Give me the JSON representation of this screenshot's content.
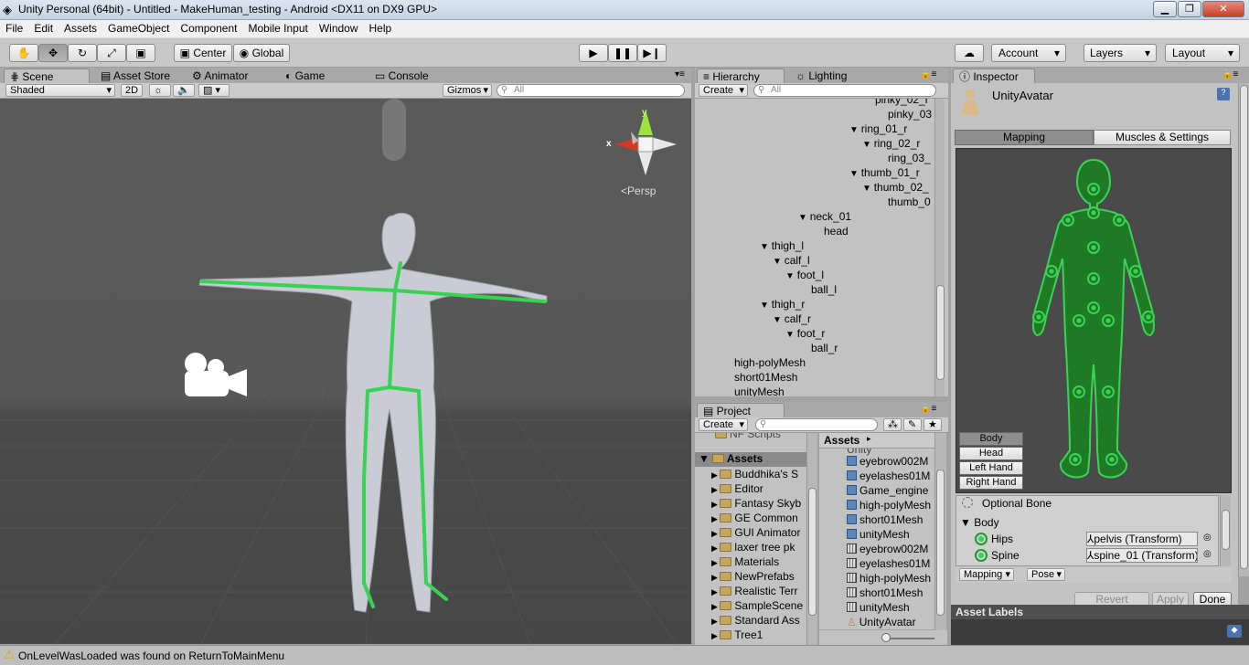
{
  "window": {
    "title": "Unity Personal (64bit) - Untitled - MakeHuman_testing - Android <DX11 on DX9 GPU>"
  },
  "menu": [
    "File",
    "Edit",
    "Assets",
    "GameObject",
    "Component",
    "Mobile Input",
    "Window",
    "Help"
  ],
  "toolbar": {
    "center_label": "Center",
    "global_label": "Global",
    "account_label": "Account",
    "layers_label": "Layers",
    "layout_label": "Layout"
  },
  "scene_tabs": [
    "Scene",
    "Asset Store",
    "Animator",
    "Game",
    "Console"
  ],
  "scene_bar": {
    "shaded": "Shaded",
    "two_d": "2D",
    "gizmos": "Gizmos",
    "search_placeholder": "All"
  },
  "scene": {
    "gizmo_x": "x",
    "gizmo_y": "y",
    "persp": "Persp"
  },
  "hierarchy": {
    "tabs": [
      "Hierarchy",
      "Lighting"
    ],
    "create_label": "Create",
    "search_placeholder": "All",
    "items": [
      {
        "label": "pinky_02_r",
        "indent": 197,
        "arrow": false
      },
      {
        "label": "pinky_03",
        "indent": 211,
        "arrow": false
      },
      {
        "label": "ring_01_r",
        "indent": 183,
        "arrow": true
      },
      {
        "label": "ring_02_r",
        "indent": 197,
        "arrow": true
      },
      {
        "label": "ring_03_",
        "indent": 211,
        "arrow": false
      },
      {
        "label": "thumb_01_r",
        "indent": 183,
        "arrow": true
      },
      {
        "label": "thumb_02_",
        "indent": 197,
        "arrow": true
      },
      {
        "label": "thumb_0",
        "indent": 211,
        "arrow": false
      },
      {
        "label": "neck_01",
        "indent": 127,
        "arrow": true
      },
      {
        "label": "head",
        "indent": 141,
        "arrow": false
      },
      {
        "label": "thigh_l",
        "indent": 85,
        "arrow": true
      },
      {
        "label": "calf_l",
        "indent": 99,
        "arrow": true
      },
      {
        "label": "foot_l",
        "indent": 113,
        "arrow": true
      },
      {
        "label": "ball_l",
        "indent": 127,
        "arrow": false
      },
      {
        "label": "thigh_r",
        "indent": 85,
        "arrow": true
      },
      {
        "label": "calf_r",
        "indent": 99,
        "arrow": true
      },
      {
        "label": "foot_r",
        "indent": 113,
        "arrow": true
      },
      {
        "label": "ball_r",
        "indent": 127,
        "arrow": false
      },
      {
        "label": "high-polyMesh",
        "indent": 43,
        "arrow": false
      },
      {
        "label": "short01Mesh",
        "indent": 43,
        "arrow": false
      },
      {
        "label": "unityMesh",
        "indent": 43,
        "arrow": false
      }
    ]
  },
  "project": {
    "tab": "Project",
    "create_label": "Create",
    "breadcrumb": "Assets",
    "partial_top_left": "NF Scripts",
    "root_label": "Assets",
    "folders": [
      "Buddhika's S",
      "Editor",
      "Fantasy Skyb",
      "GE Common",
      "GUI Animator",
      "laxer tree pk",
      "Materials",
      "NewPrefabs",
      "Realistic Terr",
      "SampleScene",
      "Standard Ass",
      "Tree1"
    ],
    "partial_top_right": "Unity",
    "assets": [
      {
        "label": "eyebrow002M",
        "kind": "mesh"
      },
      {
        "label": "eyelashes01M",
        "kind": "mesh"
      },
      {
        "label": "Game_engine",
        "kind": "mesh"
      },
      {
        "label": "high-polyMesh",
        "kind": "mesh"
      },
      {
        "label": "short01Mesh",
        "kind": "mesh"
      },
      {
        "label": "unityMesh",
        "kind": "mesh"
      },
      {
        "label": "eyebrow002M",
        "kind": "grid"
      },
      {
        "label": "eyelashes01M",
        "kind": "grid"
      },
      {
        "label": "high-polyMesh",
        "kind": "grid"
      },
      {
        "label": "short01Mesh",
        "kind": "grid"
      },
      {
        "label": "unityMesh",
        "kind": "grid"
      },
      {
        "label": "UnityAvatar",
        "kind": "avatar"
      }
    ]
  },
  "inspector": {
    "tab": "Inspector",
    "object_name": "UnityAvatar",
    "mapping_tab": "Mapping",
    "muscles_tab": "Muscles & Settings",
    "body_buttons": [
      "Body",
      "Head",
      "Left Hand",
      "Right Hand"
    ],
    "optional_bone": "Optional Bone",
    "section": "Body",
    "bones": [
      {
        "name": "Hips",
        "transform": "pelvis (Transform)"
      },
      {
        "name": "Spine",
        "transform": "spine_01 (Transform)"
      }
    ],
    "mapping_dropdown": "Mapping",
    "pose_dropdown": "Pose",
    "revert": "Revert",
    "apply": "Apply",
    "done": "Done",
    "asset_labels": "Asset Labels"
  },
  "status": {
    "message": "OnLevelWasLoaded was found on ReturnToMainMenu"
  },
  "colors": {
    "bone_green": "#39d353",
    "avatar_green": "#1f9a2a",
    "gizmo_red": "#d23a25",
    "gizmo_green": "#9be33d"
  }
}
